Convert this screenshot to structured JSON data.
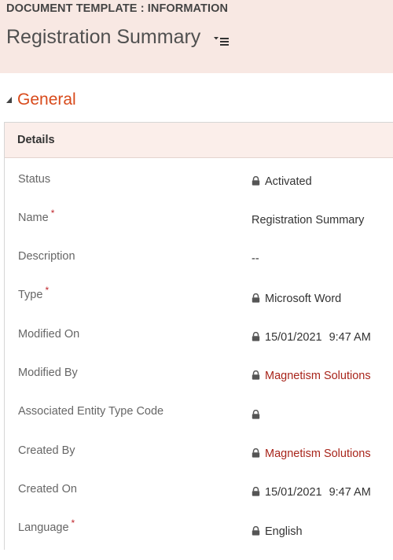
{
  "header": {
    "entity_label": "DOCUMENT TEMPLATE : INFORMATION",
    "record_title": "Registration Summary"
  },
  "section": {
    "title": "General",
    "tab_label": "Details"
  },
  "fields": {
    "status": {
      "label": "Status",
      "value": "Activated"
    },
    "name": {
      "label": "Name",
      "required": "*",
      "value": "Registration Summary"
    },
    "description": {
      "label": "Description",
      "value": "--"
    },
    "type": {
      "label": "Type",
      "required": "*",
      "value": "Microsoft Word"
    },
    "modified_on": {
      "label": "Modified On",
      "date": "15/01/2021",
      "time": "9:47 AM"
    },
    "modified_by": {
      "label": "Modified By",
      "value": "Magnetism Solutions"
    },
    "associated_entity_type_code": {
      "label": "Associated Entity Type Code",
      "value": ""
    },
    "created_by": {
      "label": "Created By",
      "value": "Magnetism Solutions"
    },
    "created_on": {
      "label": "Created On",
      "date": "15/01/2021",
      "time": "9:47 AM"
    },
    "language": {
      "label": "Language",
      "required": "*",
      "value": "English"
    }
  },
  "colors": {
    "header_bg": "#f8e8e3",
    "section_title": "#d84a1b",
    "link": "#a8251b",
    "required": "#c0272d"
  },
  "icons": [
    "form-selector-icon",
    "collapse-triangle-icon",
    "lock-icon"
  ]
}
